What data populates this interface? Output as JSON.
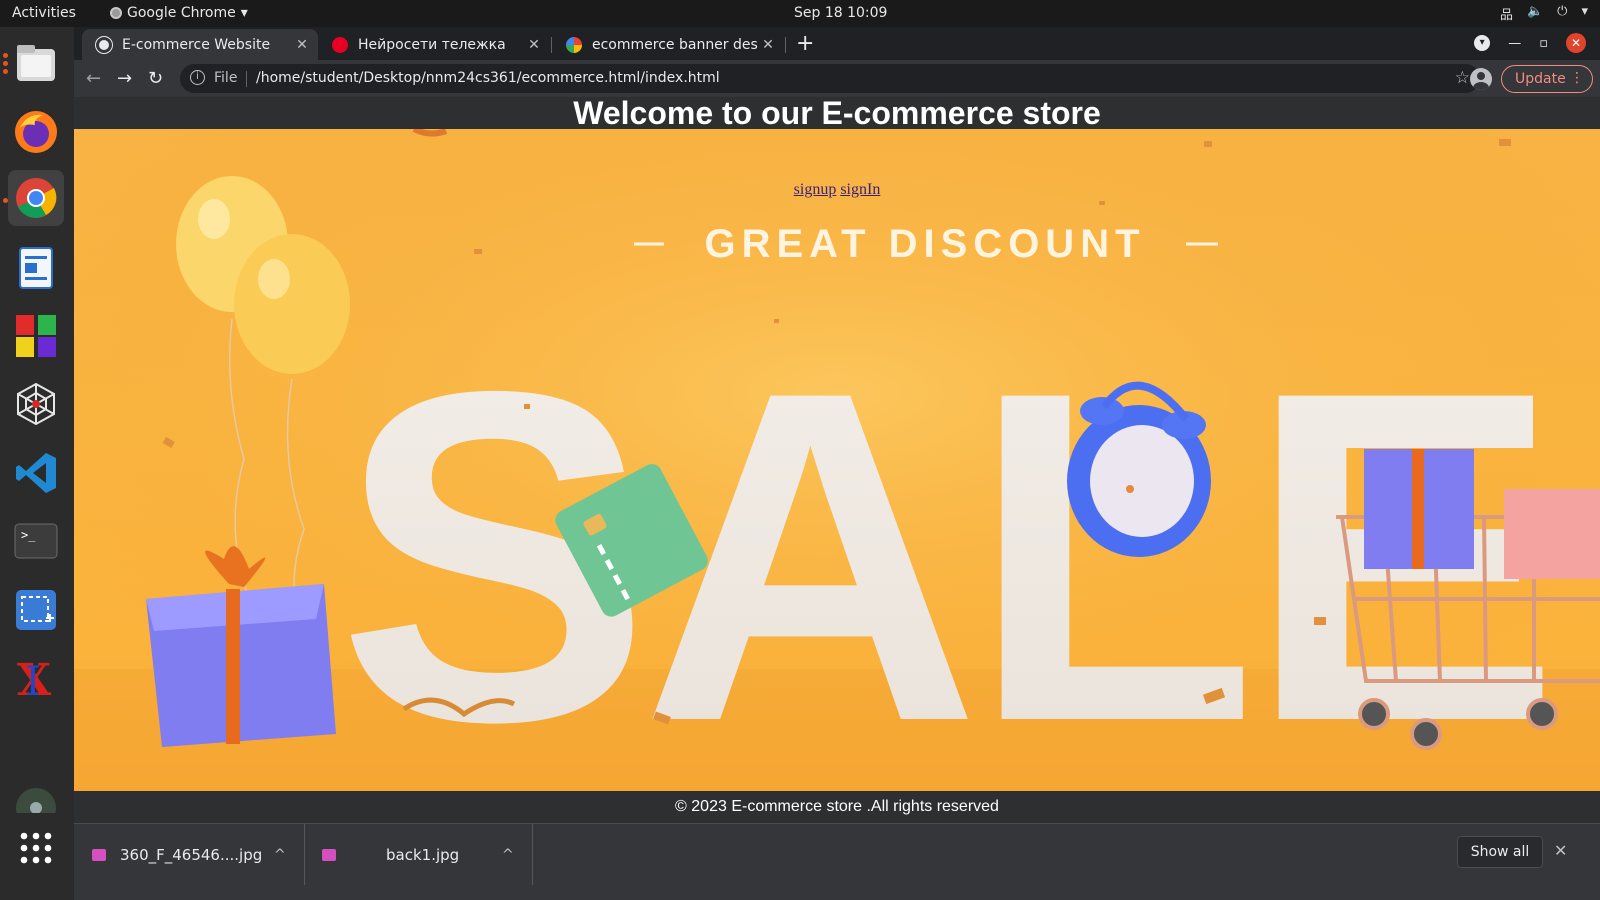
{
  "topbar": {
    "activities": "Activities",
    "app_name": "Google Chrome",
    "clock": "Sep 18  10:09"
  },
  "tabs": [
    {
      "title": "E-commerce Website",
      "icon": "globe-icon",
      "active": true
    },
    {
      "title": "Нейросети тележка",
      "icon": "pinterest-icon",
      "active": false
    },
    {
      "title": "ecommerce banner desig",
      "icon": "google-icon",
      "active": false
    }
  ],
  "toolbar": {
    "scheme": "File",
    "url": "/home/student/Desktop/nnm24cs361/ecommerce.html/index.html",
    "update_label": "Update"
  },
  "page": {
    "heading": "Welcome to our E-commerce store",
    "signup": "signup",
    "signin": "signIn",
    "banner_subtitle": "GREAT DISCOUNT",
    "banner_word": "SALE",
    "footer": "© 2023 E-commerce store .All rights reserved"
  },
  "downloads": {
    "items": [
      {
        "name": "360_F_46546....jpg"
      },
      {
        "name": "back1.jpg"
      }
    ],
    "show_all": "Show all"
  },
  "colors": {
    "banner_orange": "#f9b540",
    "chrome_dark": "#35363a",
    "update_accent": "#f28b82"
  }
}
